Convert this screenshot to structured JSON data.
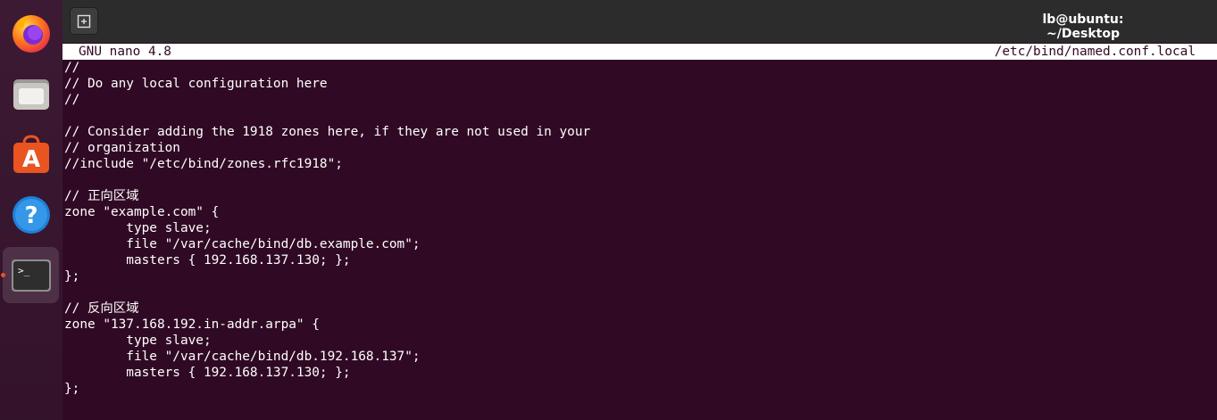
{
  "window": {
    "title": "lb@ubuntu: ~/Desktop"
  },
  "dock": {
    "items": [
      {
        "name": "Firefox"
      },
      {
        "name": "Files"
      },
      {
        "name": "Ubuntu Software"
      },
      {
        "name": "Help"
      },
      {
        "name": "Terminal",
        "active": true
      }
    ]
  },
  "nano": {
    "version": "GNU nano 4.8",
    "filename": "/etc/bind/named.conf.local",
    "lines": [
      "//",
      "// Do any local configuration here",
      "//",
      "",
      "// Consider adding the 1918 zones here, if they are not used in your",
      "// organization",
      "//include \"/etc/bind/zones.rfc1918\";",
      "",
      "// 正向区域",
      "zone \"example.com\" {",
      "        type slave;",
      "        file \"/var/cache/bind/db.example.com\";",
      "        masters { 192.168.137.130; };",
      "};",
      "",
      "// 反向区域",
      "zone \"137.168.192.in-addr.arpa\" {",
      "        type slave;",
      "        file \"/var/cache/bind/db.192.168.137\";",
      "        masters { 192.168.137.130; };",
      "};"
    ]
  },
  "colors": {
    "terminal_bg": "#300a24",
    "accent": "#e95420",
    "titlebar": "#2c2c2c"
  }
}
